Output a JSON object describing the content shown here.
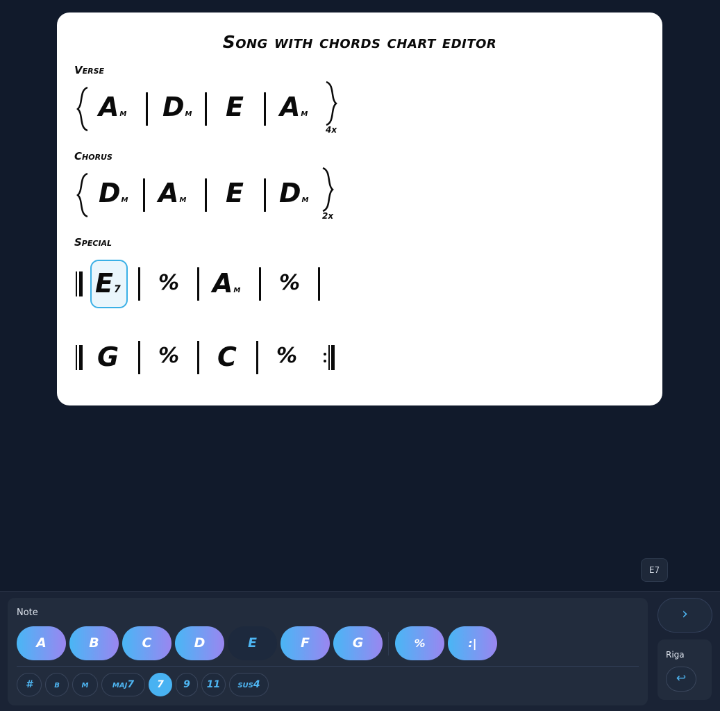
{
  "chart": {
    "title": "Song with chords chart editor",
    "sections": [
      {
        "name": "Verse",
        "repeat": "4x",
        "bars": [
          {
            "root": "A",
            "quality": "m"
          },
          {
            "root": "D",
            "quality": "m"
          },
          {
            "root": "E",
            "quality": ""
          },
          {
            "root": "A",
            "quality": "m"
          }
        ]
      },
      {
        "name": "Chorus",
        "repeat": "2x",
        "bars": [
          {
            "root": "D",
            "quality": "m"
          },
          {
            "root": "A",
            "quality": "m"
          },
          {
            "root": "E",
            "quality": ""
          },
          {
            "root": "D",
            "quality": "m"
          }
        ]
      },
      {
        "name": "Special",
        "lines": [
          [
            {
              "root": "E",
              "quality": "7",
              "selected": true
            },
            {
              "symbol": "%"
            },
            {
              "root": "A",
              "quality": "m"
            },
            {
              "symbol": "%"
            }
          ],
          [
            {
              "root": "G",
              "quality": ""
            },
            {
              "symbol": "%"
            },
            {
              "root": "C",
              "quality": ""
            },
            {
              "symbol": "%"
            }
          ]
        ]
      }
    ]
  },
  "current_chord": "E7",
  "keyboard": {
    "note_title": "Note",
    "notes": [
      "A",
      "B",
      "C",
      "D",
      "E",
      "F",
      "G"
    ],
    "active_note": "E",
    "extras": [
      "%",
      ":|"
    ],
    "modifiers": [
      "#",
      "b",
      "m",
      "maj7",
      "7",
      "9",
      "11",
      "sus4"
    ],
    "active_modifier": "7",
    "next_icon": "›",
    "row_title": "Riga",
    "newline_icon": "↩"
  },
  "colors": {
    "background": "#111a2b",
    "card": "#ffffff",
    "accent": "#4eb6f3",
    "key_gradient_start": "#49b6f5",
    "key_gradient_end": "#9a86f0",
    "selection_border": "#3ab0e6"
  },
  "icons": {
    "next": "chevron-right-icon",
    "newline": "return-arrow-icon"
  }
}
